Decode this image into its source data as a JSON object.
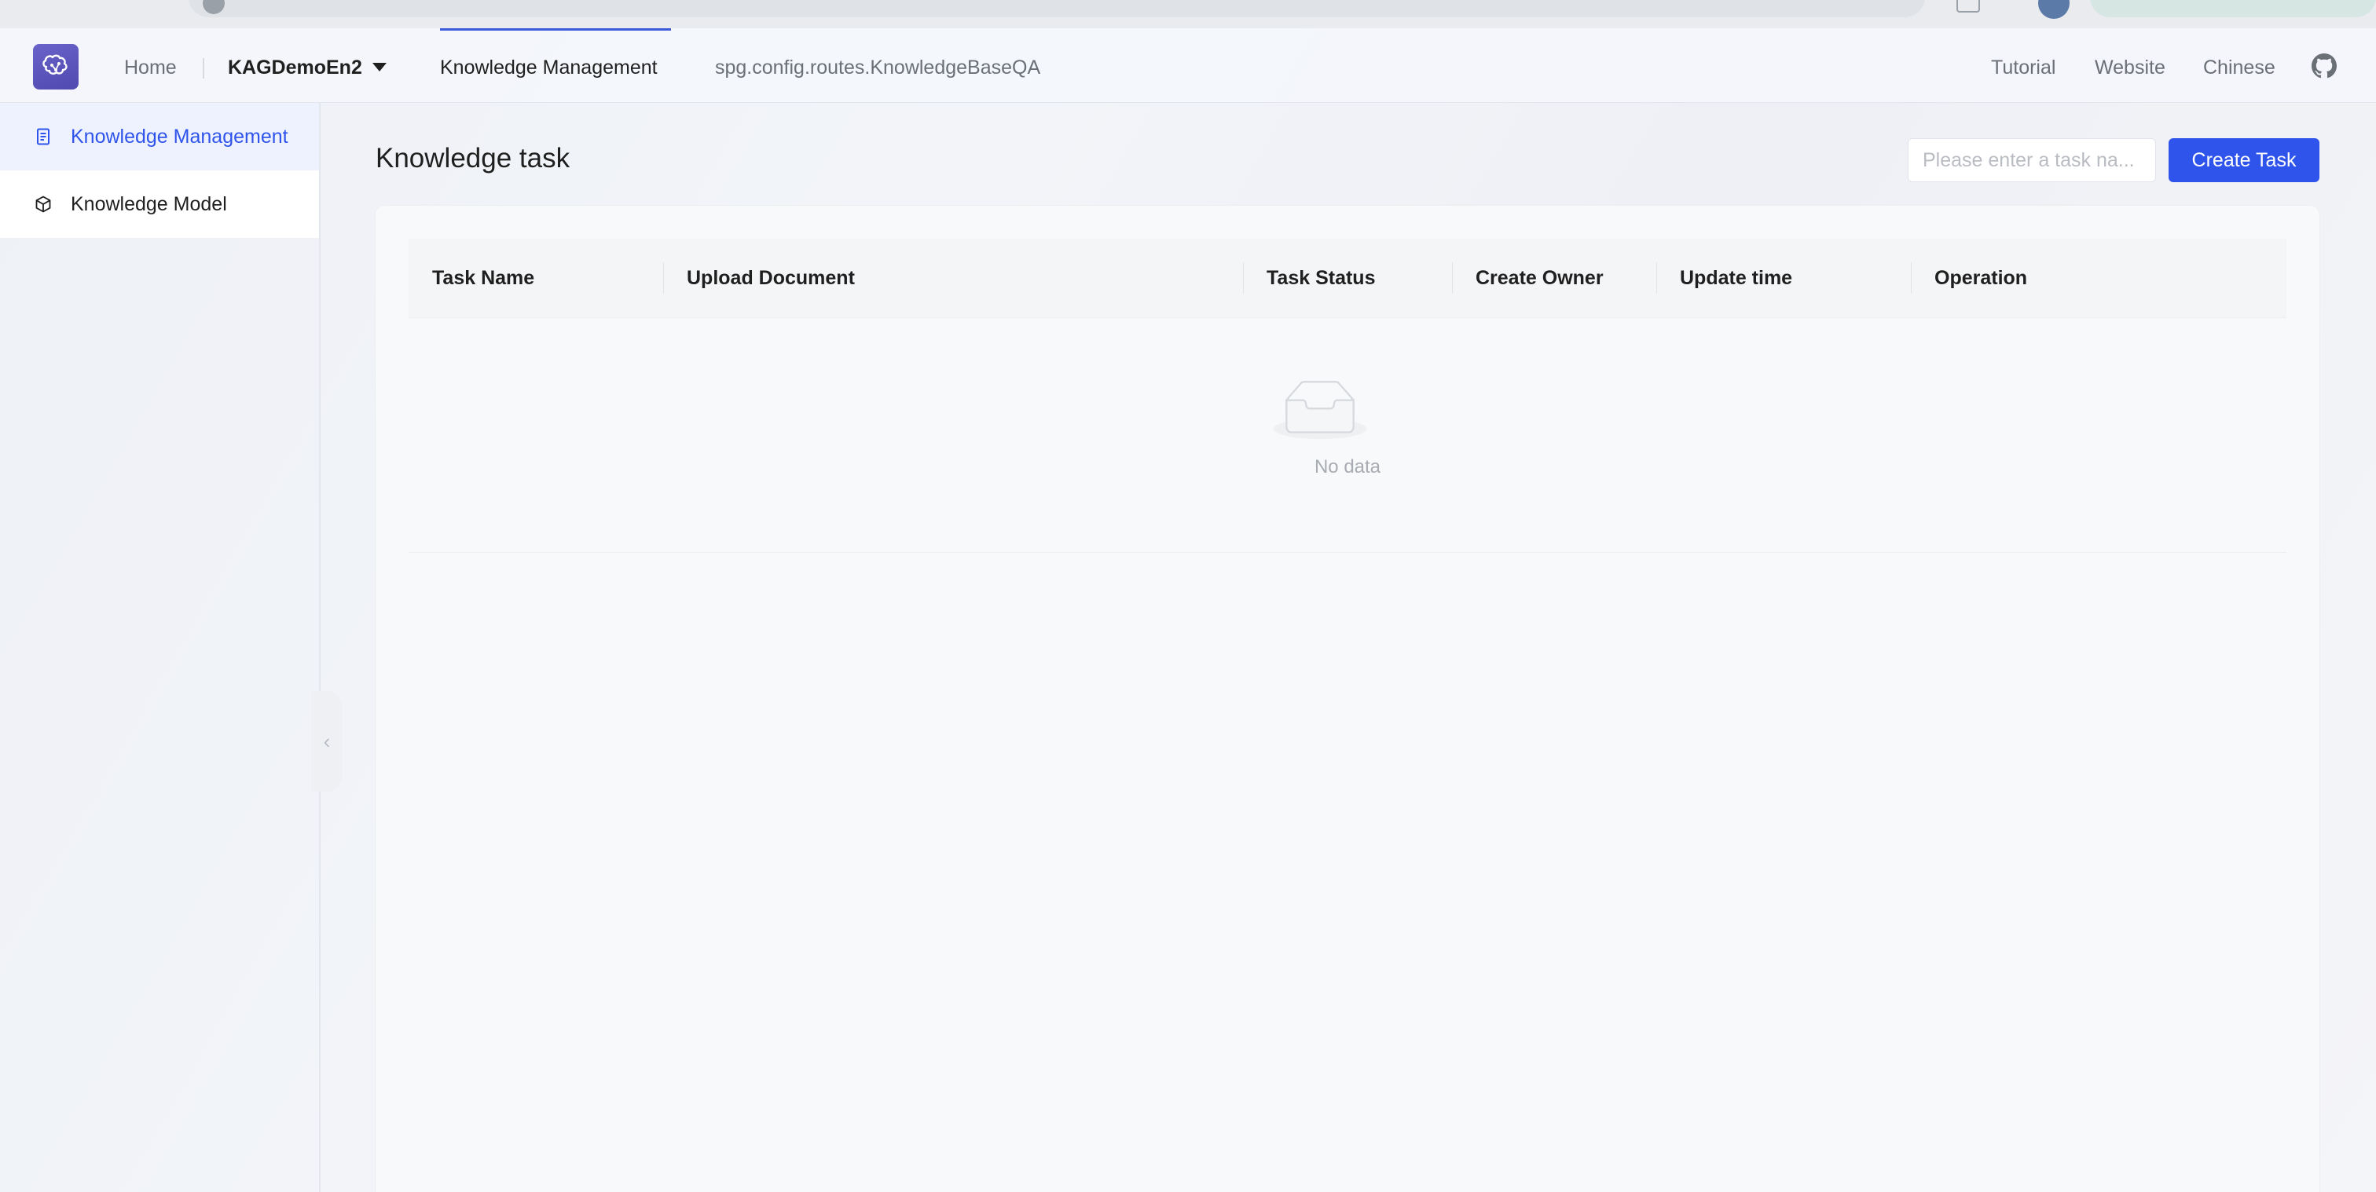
{
  "topnav": {
    "home": "Home",
    "project": "KAGDemoEn2",
    "knowledge_management": "Knowledge Management",
    "knowledge_base_qa": "spg.config.routes.KnowledgeBaseQA",
    "tutorial": "Tutorial",
    "website": "Website",
    "chinese": "Chinese"
  },
  "sidebar": {
    "items": [
      {
        "label": "Knowledge Management",
        "icon": "document-icon",
        "active": true
      },
      {
        "label": "Knowledge Model",
        "icon": "cube-icon",
        "active": false
      }
    ]
  },
  "main": {
    "title": "Knowledge task",
    "search_placeholder": "Please enter a task na...",
    "create_button": "Create Task",
    "table": {
      "columns": [
        "Task Name",
        "Upload Document",
        "Task Status",
        "Create Owner",
        "Update time",
        "Operation"
      ],
      "rows": [],
      "empty_text": "No data"
    }
  },
  "colors": {
    "accent": "#2f54eb",
    "logo": "#5a53bd"
  }
}
